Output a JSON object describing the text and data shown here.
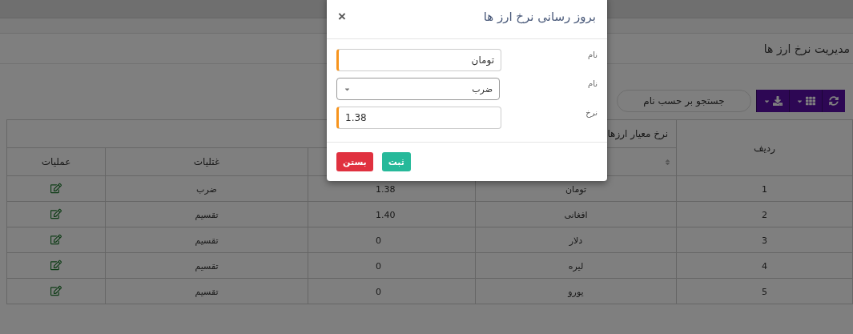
{
  "page": {
    "title": "مدیریت نرخ ارز ها"
  },
  "toolbar": {
    "search": {
      "placeholder": "جستجو بر حسب نام"
    }
  },
  "table": {
    "columns": {
      "row_number": "ردیف",
      "group": "نرخ معیار ارزها",
      "operation": "غتلیات",
      "actions": "عملیات"
    },
    "rows": [
      {
        "number": "1",
        "name": "تومان",
        "rate": "1.38",
        "operation": "ضرب"
      },
      {
        "number": "2",
        "name": "افغانی",
        "rate": "1.40",
        "operation": "تقسیم"
      },
      {
        "number": "3",
        "name": "دلار",
        "rate": "0",
        "operation": "تقسیم"
      },
      {
        "number": "4",
        "name": "لیره",
        "rate": "0",
        "operation": "تقسیم"
      },
      {
        "number": "5",
        "name": "یورو",
        "rate": "0",
        "operation": "تقسیم"
      }
    ]
  },
  "dialog": {
    "title": "بروز رسانی نرخ ارز ها",
    "close": "×",
    "fields": [
      {
        "kind": "text",
        "label": "نام",
        "value": "تومان",
        "required": true
      },
      {
        "kind": "select",
        "label": "نام",
        "value": "ضرب",
        "required": false
      },
      {
        "kind": "text",
        "label": "نرخ",
        "value": "1.38",
        "required": true
      }
    ],
    "buttons": [
      {
        "kind": "primary",
        "label": "ثبت"
      },
      {
        "kind": "danger",
        "label": "بستن"
      }
    ]
  }
}
